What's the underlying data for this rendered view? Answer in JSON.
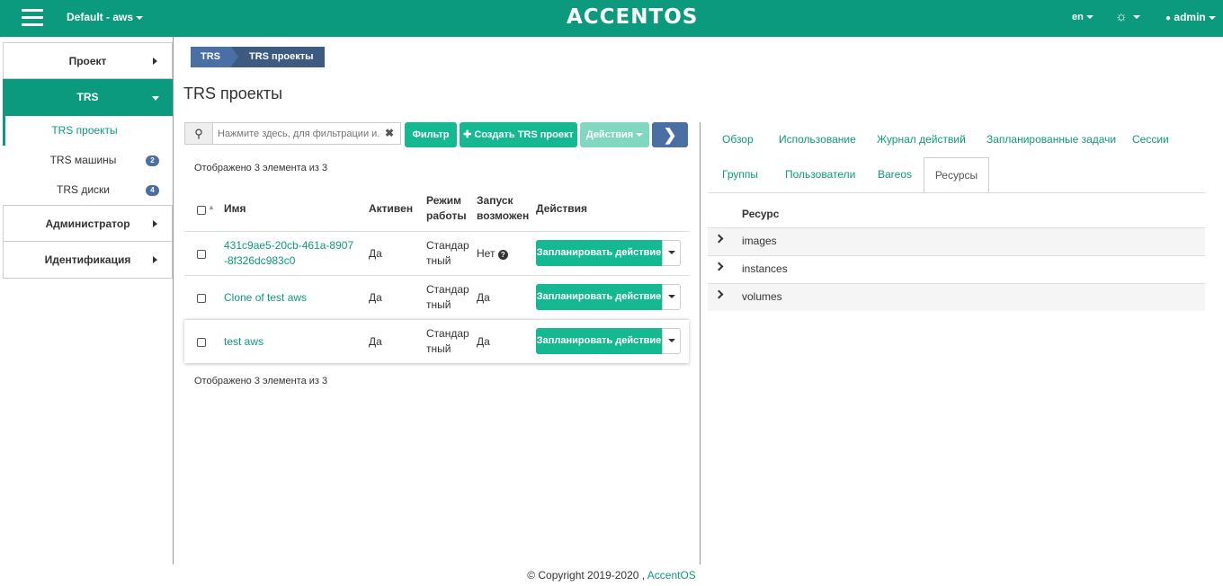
{
  "topbar": {
    "project": "Default - aws",
    "logo": "ACCENTOS",
    "lang": "en",
    "user": "admin"
  },
  "sidebar": {
    "project": "Проект",
    "trs": "TRS",
    "trs_projects": "TRS проекты",
    "trs_machines": "TRS машины",
    "trs_machines_count": "2",
    "trs_disks": "TRS диски",
    "trs_disks_count": "4",
    "admin": "Администратор",
    "identity": "Идентификация"
  },
  "breadcrumb": {
    "item1": "TRS",
    "item2": "TRS проекты"
  },
  "page_title": "TRS проекты",
  "toolbar": {
    "search_placeholder": "Нажмите здесь, для фильтрации и...",
    "filter": "Фильтр",
    "create": "Создать TRS проект",
    "actions": "Действия"
  },
  "table": {
    "count_text": "Отображено 3 элемента из 3",
    "headers": {
      "name": "Имя",
      "active": "Активен",
      "mode1": "Режим",
      "mode2": "работы",
      "launch1": "Запуск",
      "launch2": "возможен",
      "actions": "Действия"
    },
    "rows": [
      {
        "name1": "431c9ae5-20cb-461a-8907",
        "name2": "-8f326dc983c0",
        "active": "Да",
        "mode1": "Стандар",
        "mode2": "тный",
        "launch": "Нет",
        "action": "Запланировать действие"
      },
      {
        "name1": "Clone of test aws",
        "active": "Да",
        "mode1": "Стандар",
        "mode2": "тный",
        "launch": "Да",
        "action": "Запланировать действие"
      },
      {
        "name1": "test aws",
        "active": "Да",
        "mode1": "Стандар",
        "mode2": "тный",
        "launch": "Да",
        "action": "Запланировать действие"
      }
    ]
  },
  "detail": {
    "tabs": {
      "overview": "Обзор",
      "usage": "Использование",
      "log": "Журнал действий",
      "tasks": "Запланированные задачи",
      "sessions": "Сессии",
      "groups": "Группы",
      "users": "Пользователи",
      "bareos": "Bareos",
      "resources": "Ресурсы"
    },
    "resource_header": "Ресурс",
    "resources": [
      "images",
      "instances",
      "volumes"
    ]
  },
  "footer": {
    "text": "© Copyright 2019-2020 ,",
    "link": "AccentOS"
  }
}
